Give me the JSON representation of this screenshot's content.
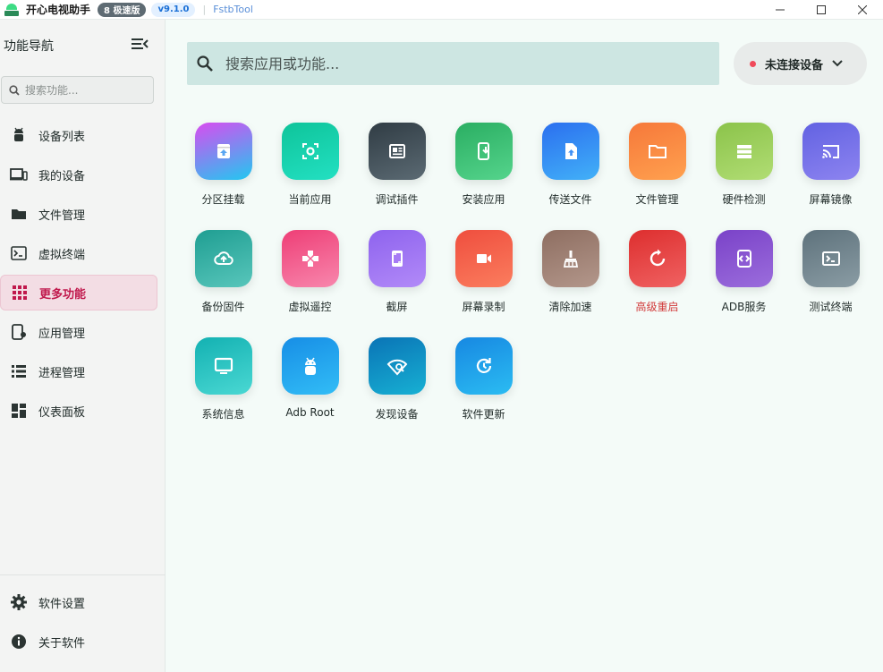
{
  "titlebar": {
    "app_title": "开心电视助手",
    "badge": "8 极速版",
    "version": "v9.1.0",
    "separator": "|",
    "tool": "FstbTool"
  },
  "sidebar": {
    "title": "功能导航",
    "search_placeholder": "搜索功能...",
    "items": [
      {
        "label": "设备列表",
        "icon": "android-icon"
      },
      {
        "label": "我的设备",
        "icon": "devices-icon"
      },
      {
        "label": "文件管理",
        "icon": "folder-icon"
      },
      {
        "label": "虚拟终端",
        "icon": "terminal-icon"
      },
      {
        "label": "更多功能",
        "icon": "apps-grid-icon",
        "active": true
      },
      {
        "label": "应用管理",
        "icon": "app-manage-icon"
      },
      {
        "label": "进程管理",
        "icon": "list-icon"
      },
      {
        "label": "仪表面板",
        "icon": "dashboard-icon"
      }
    ],
    "bottom_items": [
      {
        "label": "软件设置",
        "icon": "gear-icon"
      },
      {
        "label": "关于软件",
        "icon": "info-icon"
      }
    ]
  },
  "main": {
    "search_placeholder": "搜索应用或功能...",
    "device_status": "未连接设备",
    "status_color": "#f04a5a",
    "tiles": [
      {
        "label": "分区挂载",
        "icon": "partition-mount-icon",
        "colors": [
          "#d94cf0",
          "#21c8f0"
        ]
      },
      {
        "label": "当前应用",
        "icon": "focus-app-icon",
        "colors": [
          "#0ec49a",
          "#23e0c2"
        ]
      },
      {
        "label": "调试插件",
        "icon": "plugin-icon",
        "colors": [
          "#303c44",
          "#5b6a73"
        ]
      },
      {
        "label": "安装应用",
        "icon": "install-app-icon",
        "colors": [
          "#2aae62",
          "#55d48c"
        ]
      },
      {
        "label": "传送文件",
        "icon": "upload-file-icon",
        "colors": [
          "#2b6fef",
          "#42b1f8"
        ]
      },
      {
        "label": "文件管理",
        "icon": "folder-icon",
        "colors": [
          "#f6783a",
          "#ffa14f"
        ]
      },
      {
        "label": "硬件检测",
        "icon": "hardware-icon",
        "colors": [
          "#8bc34a",
          "#b1dd74"
        ]
      },
      {
        "label": "屏幕镜像",
        "icon": "cast-icon",
        "colors": [
          "#6262e2",
          "#8d84f0"
        ]
      },
      {
        "label": "备份固件",
        "icon": "cloud-upload-icon",
        "colors": [
          "#1f9e92",
          "#58c6bb"
        ]
      },
      {
        "label": "虚拟遥控",
        "icon": "gamepad-icon",
        "colors": [
          "#ee3e76",
          "#f887ad"
        ]
      },
      {
        "label": "截屏",
        "icon": "screenshot-icon",
        "colors": [
          "#8e63ee",
          "#b28af8"
        ]
      },
      {
        "label": "屏幕录制",
        "icon": "videocam-icon",
        "colors": [
          "#ef4e3e",
          "#fb7d5e"
        ]
      },
      {
        "label": "清除加速",
        "icon": "broom-icon",
        "colors": [
          "#8e6e61",
          "#b3978b"
        ]
      },
      {
        "label": "高级重启",
        "icon": "restart-icon",
        "colors": [
          "#dd2e2e",
          "#f06262"
        ],
        "warn": true
      },
      {
        "label": "ADB服务",
        "icon": "adb-service-icon",
        "colors": [
          "#7a42c8",
          "#9b6ddc"
        ]
      },
      {
        "label": "测试终端",
        "icon": "terminal-icon",
        "colors": [
          "#5e727c",
          "#8a9ca4"
        ]
      },
      {
        "label": "系统信息",
        "icon": "monitor-icon",
        "colors": [
          "#13b1b2",
          "#4ad8d3"
        ]
      },
      {
        "label": "Adb Root",
        "icon": "android-icon",
        "colors": [
          "#178ee6",
          "#32bdf6"
        ]
      },
      {
        "label": "发现设备",
        "icon": "wifi-find-icon",
        "colors": [
          "#0a74b6",
          "#17b0d3"
        ]
      },
      {
        "label": "软件更新",
        "icon": "update-icon",
        "colors": [
          "#1788e2",
          "#2bbcf2"
        ]
      }
    ]
  }
}
